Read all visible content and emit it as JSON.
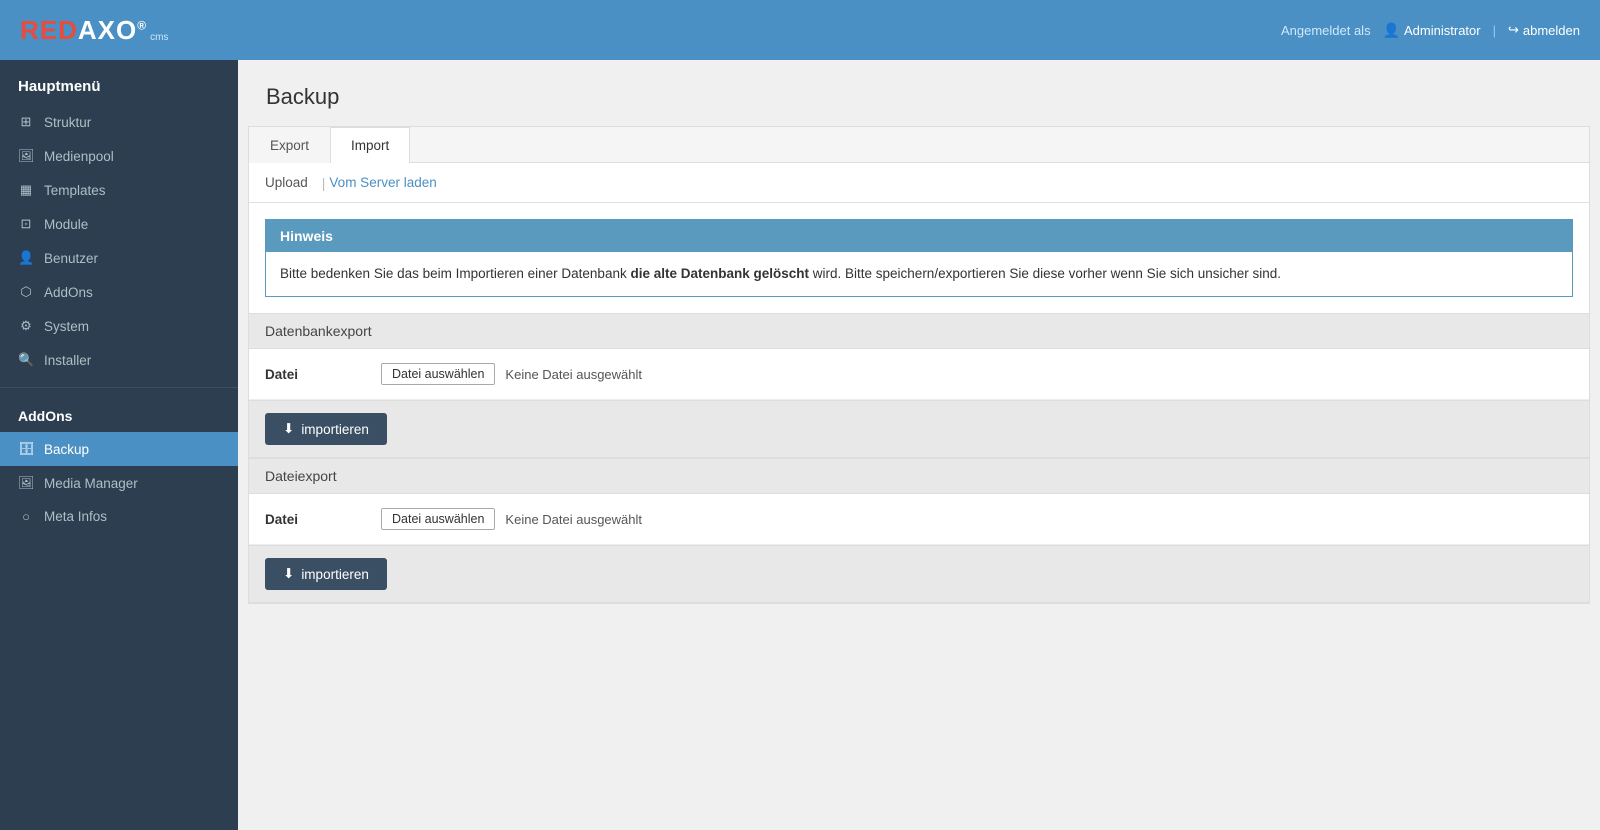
{
  "header": {
    "logo_red": "RED",
    "logo_axo": "AXO",
    "logo_cms": "cms",
    "logo_registered": "®",
    "logged_in_label": "Angemeldet als",
    "user_name": "Administrator",
    "logout_label": "abmelden"
  },
  "sidebar": {
    "hauptmenu_title": "Hauptmenü",
    "items": [
      {
        "id": "struktur",
        "label": "Struktur",
        "icon": "icon-struct"
      },
      {
        "id": "medienpool",
        "label": "Medienpool",
        "icon": "icon-media"
      },
      {
        "id": "templates",
        "label": "Templates",
        "icon": "icon-templates"
      },
      {
        "id": "module",
        "label": "Module",
        "icon": "icon-modules"
      },
      {
        "id": "benutzer",
        "label": "Benutzer",
        "icon": "icon-users"
      },
      {
        "id": "addons",
        "label": "AddOns",
        "icon": "icon-addons"
      },
      {
        "id": "system",
        "label": "System",
        "icon": "icon-system"
      },
      {
        "id": "installer",
        "label": "Installer",
        "icon": "icon-installer"
      }
    ],
    "addons_title": "AddOns",
    "addon_items": [
      {
        "id": "backup",
        "label": "Backup",
        "icon": "icon-backup",
        "active": true
      },
      {
        "id": "media-manager",
        "label": "Media Manager",
        "icon": "icon-mediamgr"
      },
      {
        "id": "meta-infos",
        "label": "Meta Infos",
        "icon": "icon-metainfo"
      }
    ]
  },
  "page": {
    "title": "Backup",
    "tabs": [
      {
        "id": "export",
        "label": "Export"
      },
      {
        "id": "import",
        "label": "Import",
        "active": true
      }
    ],
    "sub_nav": [
      {
        "id": "upload",
        "label": "Upload",
        "active": false
      },
      {
        "id": "vom-server-laden",
        "label": "Vom Server laden",
        "active": true
      }
    ],
    "notice": {
      "header": "Hinweis",
      "body_prefix": "Bitte bedenken Sie das beim Importieren einer Datenbank ",
      "body_bold": "die alte Datenbank gelöscht",
      "body_suffix": " wird. Bitte speichern/exportieren Sie diese vorher wenn Sie sich unsicher sind."
    },
    "db_export_section": {
      "title": "Datenbankexport",
      "datei_label": "Datei",
      "file_btn_label": "Datei auswählen",
      "no_file_label": "Keine Datei ausgewählt",
      "import_btn_label": "importieren"
    },
    "file_export_section": {
      "title": "Dateiexport",
      "datei_label": "Datei",
      "file_btn_label": "Datei auswählen",
      "no_file_label": "Keine Datei ausgewählt",
      "import_btn_label": "importieren"
    }
  }
}
